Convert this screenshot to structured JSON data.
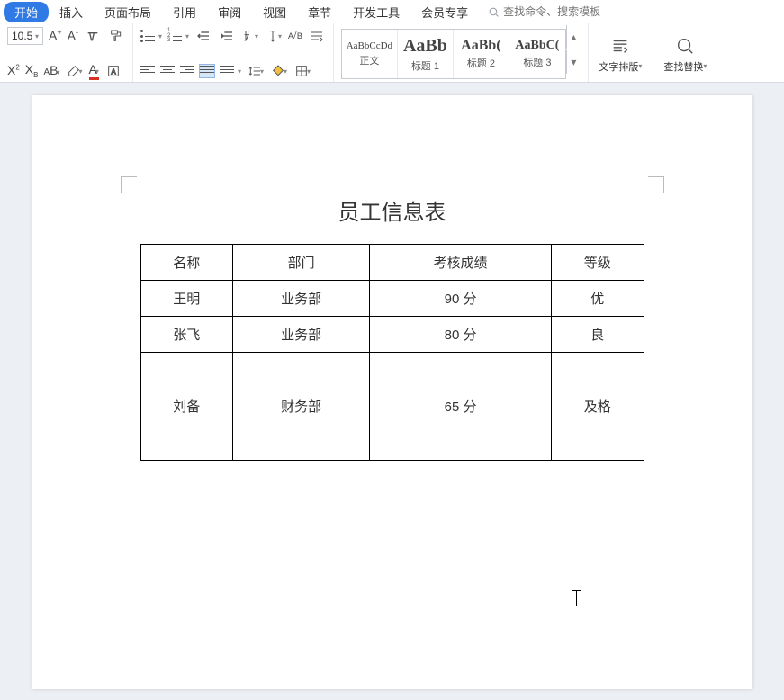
{
  "tabs": {
    "items": [
      "开始",
      "插入",
      "页面布局",
      "引用",
      "审阅",
      "视图",
      "章节",
      "开发工具",
      "会员专享"
    ],
    "active_index": 0
  },
  "search": {
    "placeholder": "查找命令、搜索模板"
  },
  "font": {
    "size": "10.5"
  },
  "style_gallery": [
    {
      "preview": "AaBbCcDd",
      "label": "正文",
      "size": "11px",
      "weight": "normal"
    },
    {
      "preview": "AaBb",
      "label": "标题 1",
      "size": "20px",
      "weight": "bold"
    },
    {
      "preview": "AaBb(",
      "label": "标题 2",
      "size": "16px",
      "weight": "bold"
    },
    {
      "preview": "AaBbC(",
      "label": "标题 3",
      "size": "14px",
      "weight": "bold"
    }
  ],
  "big_buttons": {
    "text_layout": "文字排版",
    "find_replace": "查找替换"
  },
  "document": {
    "title": "员工信息表",
    "headers": [
      "名称",
      "部门",
      "考核成绩",
      "等级"
    ],
    "rows": [
      {
        "cells": [
          "王明",
          "业务部",
          "90 分",
          "优"
        ],
        "tall": false
      },
      {
        "cells": [
          "张飞",
          "业务部",
          "80 分",
          "良"
        ],
        "tall": false
      },
      {
        "cells": [
          "刘备",
          "财务部",
          "65 分",
          "及格"
        ],
        "tall": true
      }
    ]
  },
  "icons": {
    "grow": "A",
    "shrink": "A",
    "ul_a": "A",
    "ul_b": "B",
    "ul_s": "S",
    "x2": "X",
    "x2s": "2",
    "xb": "X",
    "xbs": "B",
    "a2a": "A",
    "a2b": "B"
  }
}
